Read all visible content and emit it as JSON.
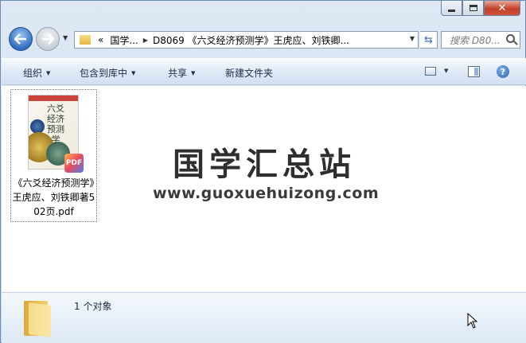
{
  "address": {
    "overflow": "«",
    "segments": [
      "国学...",
      "D8069 《六爻经济预测学》王虎应、刘铁卿..."
    ]
  },
  "search": {
    "placeholder": "搜索 D80..."
  },
  "toolbar": {
    "organize": "组织",
    "include_in_library": "包含到库中",
    "share": "共享",
    "new_folder": "新建文件夹"
  },
  "file": {
    "name": "《六爻经济预测学》王虎应、刘铁卿著502页.pdf",
    "thumbnail_title": "六爻经济预测学",
    "badge": "PDF"
  },
  "watermark": {
    "title": "国学汇总站",
    "url": "www.guoxuehuizong.com"
  },
  "details": {
    "count": "1 个对象"
  }
}
